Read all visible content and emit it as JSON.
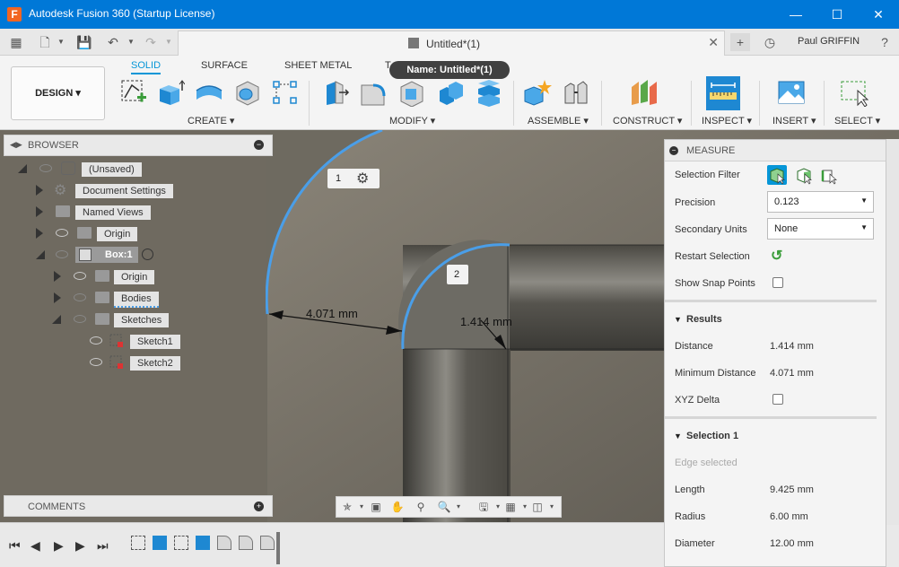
{
  "window": {
    "title": "Autodesk Fusion 360 (Startup License)",
    "logo": "F"
  },
  "user": {
    "name": "Paul GRIFFIN"
  },
  "document": {
    "tab_title": "Untitled*(1)",
    "tooltip": "Name: Untitled*(1)"
  },
  "workspace": {
    "label": "DESIGN"
  },
  "ribbon": {
    "tabs": [
      "SOLID",
      "SURFACE",
      "SHEET METAL",
      "T"
    ],
    "groups": {
      "create": "CREATE",
      "modify": "MODIFY",
      "assemble": "ASSEMBLE",
      "construct": "CONSTRUCT",
      "inspect": "INSPECT",
      "insert": "INSERT",
      "select": "SELECT"
    }
  },
  "browser": {
    "title": "BROWSER",
    "items": [
      {
        "label": "(Unsaved)"
      },
      {
        "label": "Document Settings"
      },
      {
        "label": "Named Views"
      },
      {
        "label": "Origin"
      },
      {
        "label": "Box:1"
      },
      {
        "label": "Origin"
      },
      {
        "label": "Bodies"
      },
      {
        "label": "Sketches"
      },
      {
        "label": "Sketch1"
      },
      {
        "label": "Sketch2"
      }
    ]
  },
  "comments": {
    "title": "COMMENTS"
  },
  "viewport": {
    "selection_1_badge": "1",
    "selection_2_badge": "2",
    "dim_min_distance": "4.071 mm",
    "dim_distance": "1.414 mm"
  },
  "measure": {
    "title": "MEASURE",
    "selection_filter_label": "Selection Filter",
    "precision_label": "Precision",
    "precision_value": "0.123",
    "secondary_units_label": "Secondary Units",
    "secondary_units_value": "None",
    "restart_selection_label": "Restart Selection",
    "show_snap_points_label": "Show Snap Points",
    "results_title": "Results",
    "distance_label": "Distance",
    "distance_value": "1.414 mm",
    "min_distance_label": "Minimum Distance",
    "min_distance_value": "4.071 mm",
    "xyz_delta_label": "XYZ Delta",
    "selection1_title": "Selection 1",
    "selection1_status": "Edge selected",
    "length_label": "Length",
    "length_value": "9.425 mm",
    "radius_label": "Radius",
    "radius_value": "6.00 mm",
    "diameter_label": "Diameter",
    "diameter_value": "12.00 mm"
  },
  "colors": {
    "titlebar": "#0078d7",
    "accent": "#0696d7",
    "selection_edge": "#4a9ee8"
  }
}
